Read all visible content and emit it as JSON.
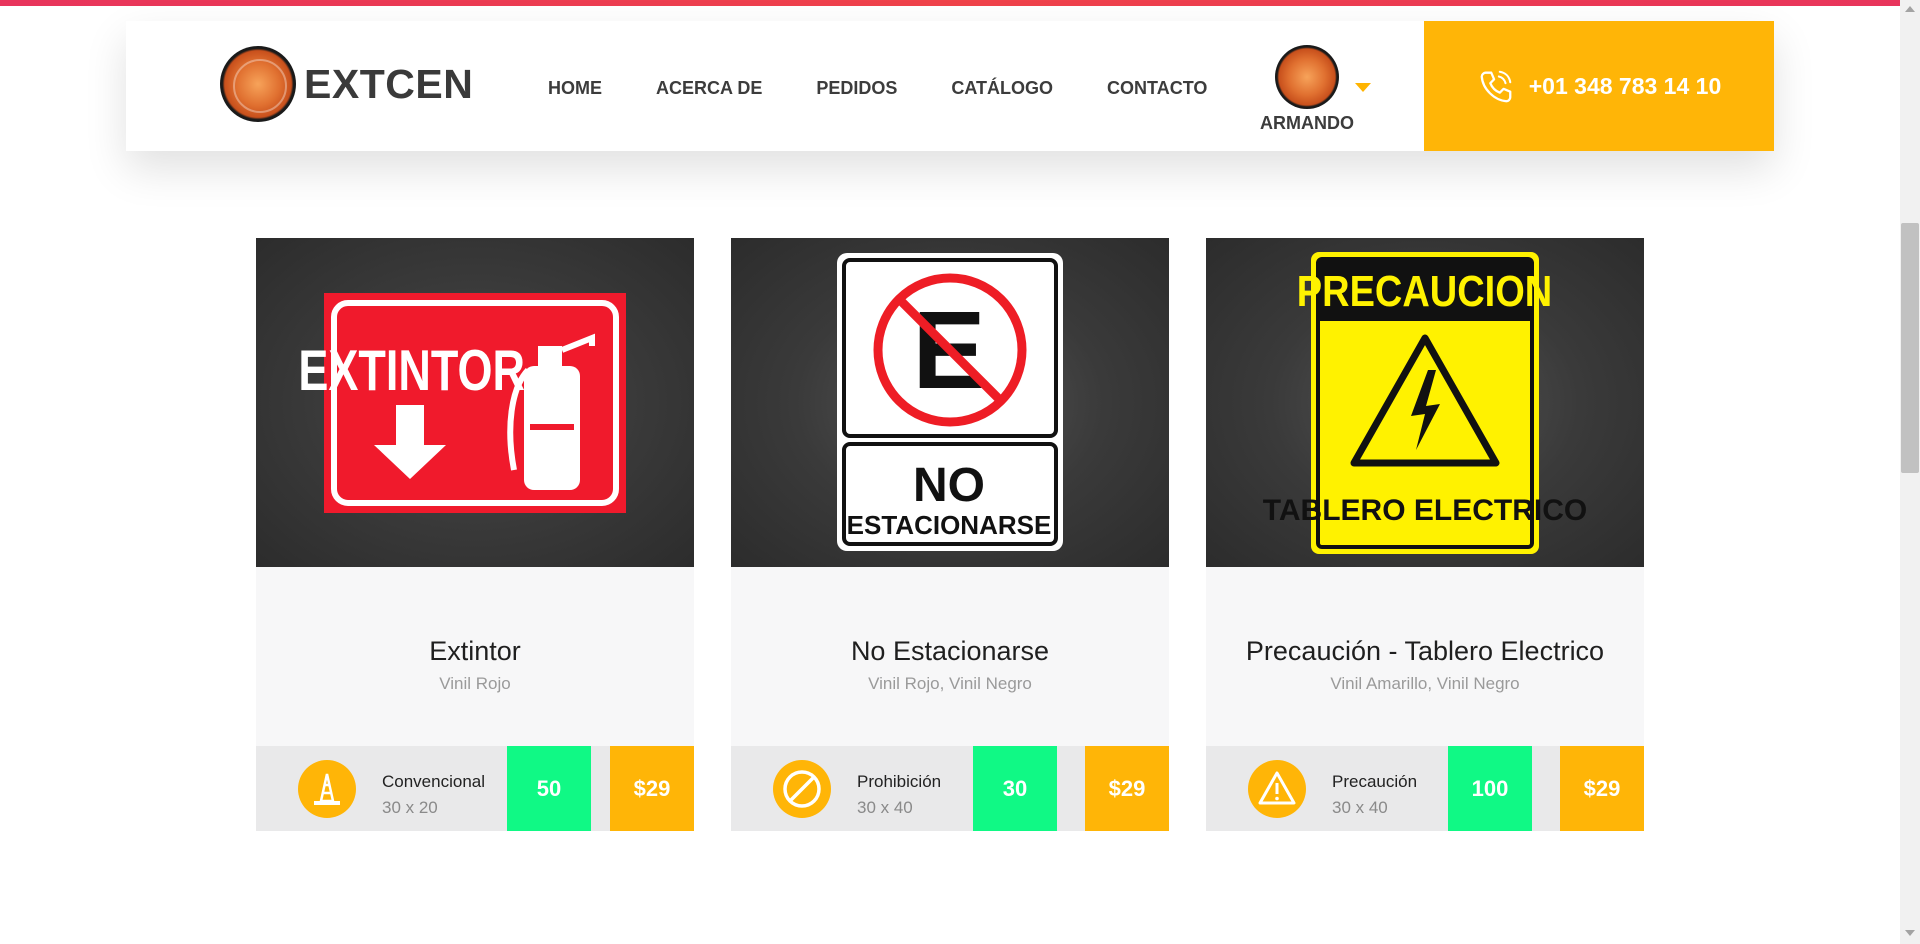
{
  "brand": {
    "name": "EXTCEN"
  },
  "nav": [
    {
      "label": "HOME"
    },
    {
      "label": "ACERCA DE"
    },
    {
      "label": "PEDIDOS"
    },
    {
      "label": "CATÁLOGO"
    },
    {
      "label": "CONTACTO"
    }
  ],
  "user": {
    "name": "ARMANDO"
  },
  "phone": {
    "number": "+01 348 783 14 10"
  },
  "colors": {
    "accent": "#ffb507",
    "quantity": "#10f985",
    "topline": "#e8345c"
  },
  "products": [
    {
      "sign_text": [
        "EXTINTOR"
      ],
      "title": "Extintor",
      "materials": "Vinil Rojo",
      "type": "Convencional",
      "type_icon": "traffic-cone-icon",
      "size": "30 x 20",
      "quantity": "50",
      "price": "$29"
    },
    {
      "sign_text": [
        "E",
        "NO",
        "ESTACIONARSE"
      ],
      "title": "No Estacionarse",
      "materials": "Vinil Rojo, Vinil Negro",
      "type": "Prohibición",
      "type_icon": "prohibition-icon",
      "size": "30 x 40",
      "quantity": "30",
      "price": "$29"
    },
    {
      "sign_text": [
        "PRECAUCION",
        "TABLERO ELECTRICO"
      ],
      "title": "Precaución - Tablero Electrico",
      "materials": "Vinil Amarillo, Vinil Negro",
      "type": "Precaución",
      "type_icon": "warning-icon",
      "size": "30 x 40",
      "quantity": "100",
      "price": "$29"
    }
  ]
}
